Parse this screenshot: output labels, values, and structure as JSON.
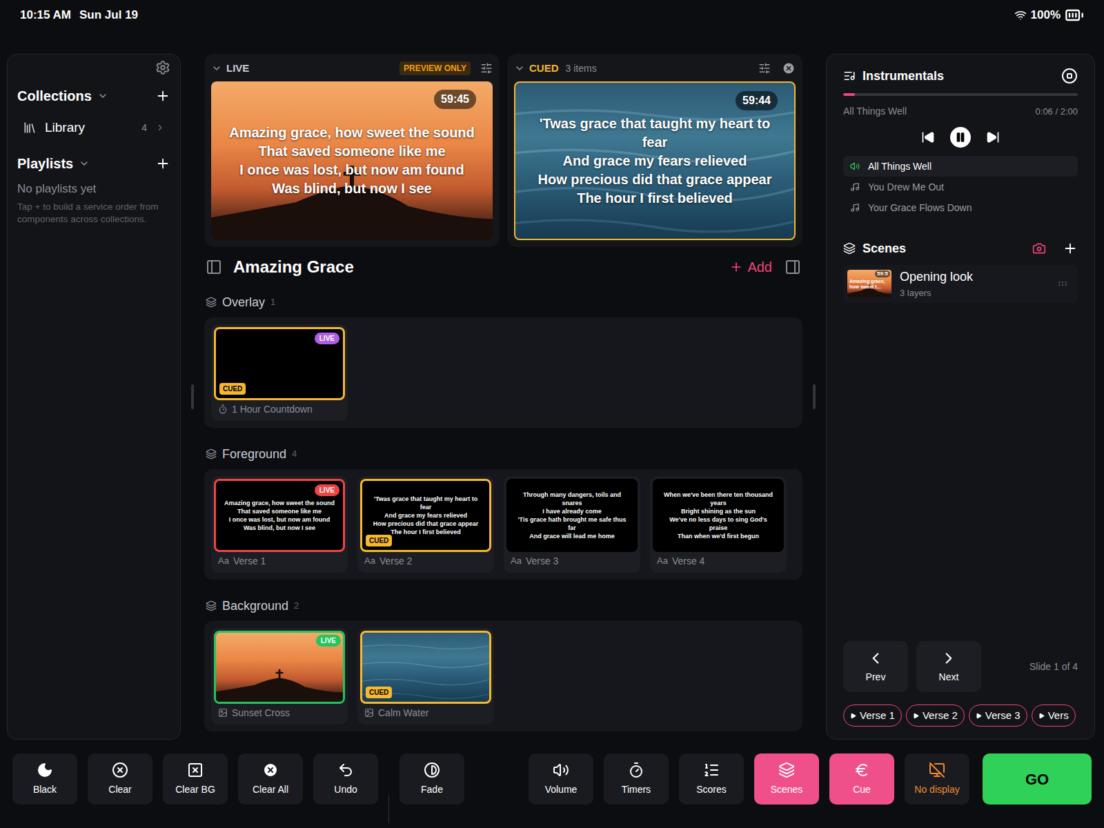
{
  "status_bar": {
    "time": "10:15 AM",
    "date": "Sun Jul 19",
    "battery": "100%"
  },
  "sidebar": {
    "collections": {
      "title": "Collections",
      "expanded": true,
      "items": [
        {
          "label": "Library",
          "count": "4"
        }
      ]
    },
    "playlists": {
      "title": "Playlists",
      "expanded": true,
      "empty_title": "No playlists yet",
      "empty_hint": "Tap + to build a service order from components across collections."
    }
  },
  "live": {
    "label": "LIVE",
    "expanded": true,
    "badge": "PREVIEW ONLY",
    "timer": "59:45",
    "picture": "sunset",
    "lines": [
      "Amazing grace, how sweet the sound",
      "That saved someone like me",
      "I once was lost, but now am found",
      "Was blind, but now I see"
    ]
  },
  "cued": {
    "label": "CUED",
    "expanded": true,
    "count": "3 items",
    "timer": "59:44",
    "picture": "water",
    "lines": [
      "'Twas grace that taught my heart to fear",
      "And grace my fears relieved",
      "How precious did that grace appear",
      "The hour I first believed"
    ]
  },
  "presentation": {
    "title": "Amazing Grace",
    "add_button": "Add"
  },
  "badges": {
    "live": "LIVE",
    "cued": "CUED"
  },
  "layers": [
    {
      "name": "Overlay",
      "count": "1",
      "color": "#b15ee6",
      "items": [
        {
          "label": "1 Hour Countdown",
          "kind": "timer",
          "live": true,
          "cued": true,
          "lines": []
        }
      ]
    },
    {
      "name": "Foreground",
      "count": "4",
      "color": "#ef4444",
      "items": [
        {
          "label": "Verse 1",
          "kind": "text",
          "icon_text": "Aa",
          "live": true,
          "cued": false,
          "lines": [
            "Amazing grace, how sweet the sound",
            "That saved someone like me",
            "I once was lost, but now am found",
            "Was blind, but now I see"
          ]
        },
        {
          "label": "Verse 2",
          "kind": "text",
          "icon_text": "Aa",
          "live": false,
          "cued": true,
          "lines": [
            "'Twas grace that taught my heart to fear",
            "And grace my fears relieved",
            "How precious did that grace appear",
            "The hour I first believed"
          ]
        },
        {
          "label": "Verse 3",
          "kind": "text",
          "icon_text": "Aa",
          "live": false,
          "cued": false,
          "lines": [
            "Through many dangers, toils and snares",
            "I have already come",
            "'Tis grace hath brought me safe thus far",
            "And grace will lead me home"
          ]
        },
        {
          "label": "Verse 4",
          "kind": "text",
          "icon_text": "Aa",
          "live": false,
          "cued": false,
          "lines": [
            "When we've been there ten thousand years",
            "Bright shining as the sun",
            "We've no less days to sing God's praise",
            "Than when we'd first begun"
          ]
        }
      ]
    },
    {
      "name": "Background",
      "count": "2",
      "color": "#22c55e",
      "items": [
        {
          "label": "Sunset Cross",
          "kind": "image",
          "picture": "sunset",
          "live": true,
          "cued": false,
          "lines": []
        },
        {
          "label": "Calm Water",
          "kind": "image",
          "picture": "water",
          "live": false,
          "cued": true,
          "lines": []
        }
      ]
    }
  ],
  "player": {
    "title": "Instrumentals",
    "playing": true,
    "current": "All Things Well",
    "position": "0:06 / 2:00",
    "level": 0.05,
    "tracks": [
      {
        "title": "All Things Well",
        "selected": true
      },
      {
        "title": "You Drew Me Out",
        "selected": false
      },
      {
        "title": "Your Grace Flows Down",
        "selected": false
      }
    ]
  },
  "scenes": {
    "title": "Scenes",
    "items": [
      {
        "name": "Opening look",
        "layers": "3 layers",
        "picture": "sunset",
        "thumb_timer": "59:5",
        "thumb_lines": [
          "Amazing grace,",
          "how sweet t..."
        ]
      }
    ]
  },
  "navigation": {
    "prev": "Prev",
    "next": "Next",
    "position": "Slide 1 of 4",
    "chips": [
      {
        "label": "Verse 1"
      },
      {
        "label": "Verse 2"
      },
      {
        "label": "Verse 3"
      },
      {
        "label": "Vers"
      }
    ]
  },
  "toolbar": {
    "edit_buttons": [
      {
        "label": "Black"
      },
      {
        "label": "Clear"
      },
      {
        "label": "Clear BG"
      },
      {
        "label": "Clear All"
      },
      {
        "label": "Undo"
      }
    ],
    "transition_buttons": [
      {
        "label": "Fade"
      }
    ],
    "output_buttons": [
      {
        "label": "Volume",
        "kind": "button",
        "active": false,
        "alert": false
      },
      {
        "label": "Timers",
        "kind": "button",
        "active": false,
        "alert": false
      },
      {
        "label": "Scores",
        "kind": "button",
        "active": false,
        "alert": false
      },
      {
        "label": "Scenes",
        "kind": "button",
        "active": true,
        "alert": false
      },
      {
        "label": "Cue",
        "kind": "button",
        "active": true,
        "alert": false
      },
      {
        "label": "No display",
        "kind": "button",
        "active": false,
        "alert": true
      },
      {
        "label": "GO",
        "kind": "go",
        "active": false,
        "alert": false
      }
    ]
  }
}
